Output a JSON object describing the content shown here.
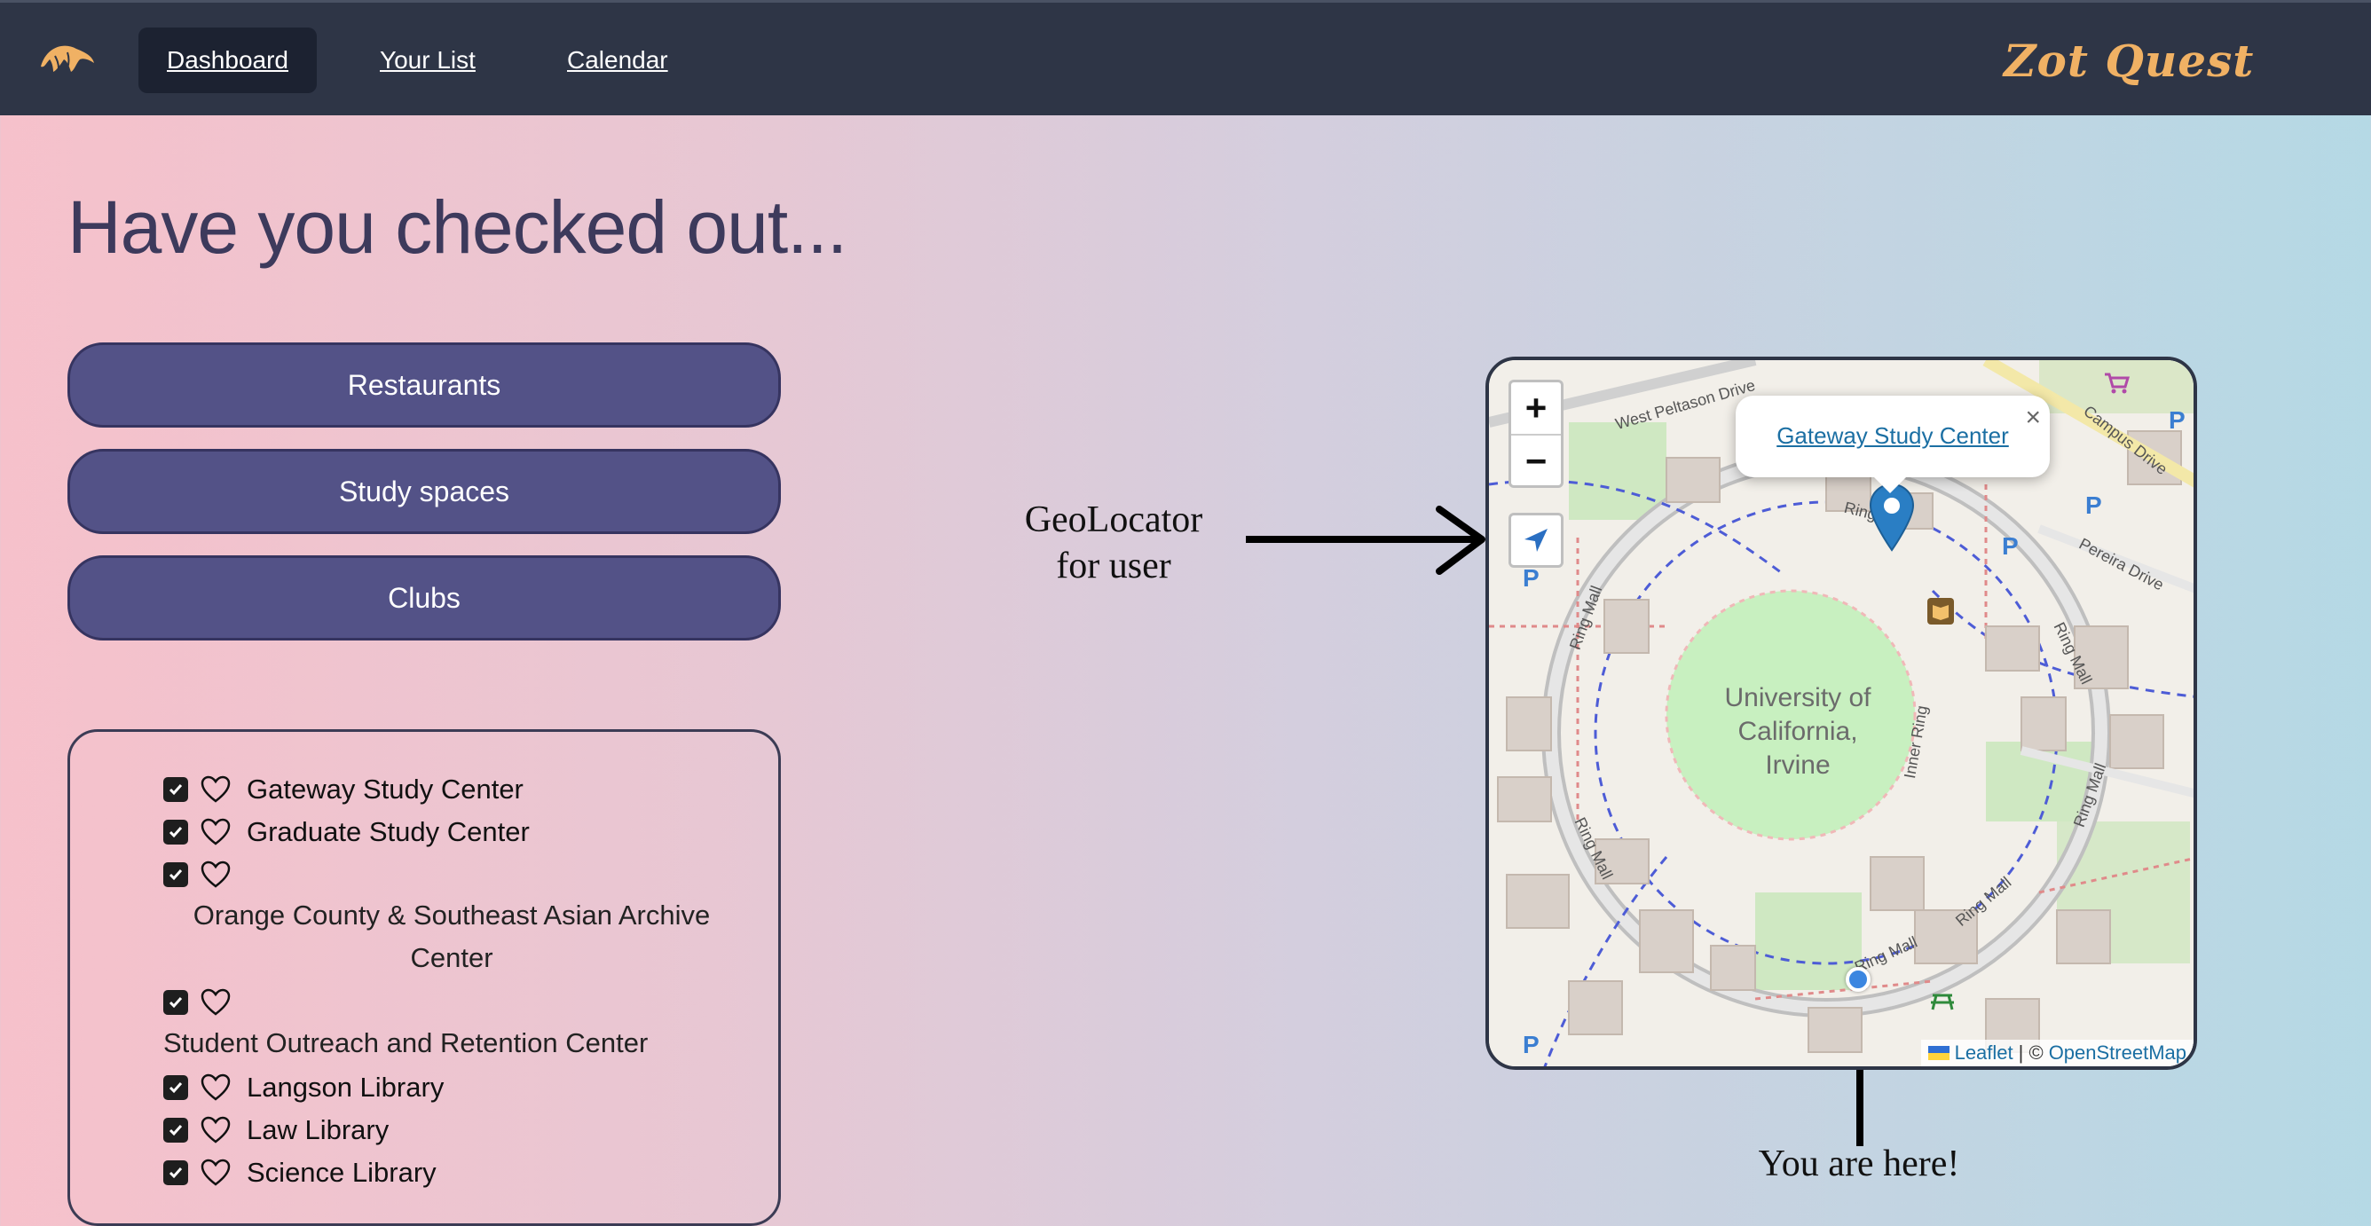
{
  "nav": {
    "logo_icon": "anteater-logo-icon",
    "links": [
      {
        "label": "Dashboard",
        "active": true
      },
      {
        "label": "Your List",
        "active": false
      },
      {
        "label": "Calendar",
        "active": false
      }
    ],
    "brand": "Zot Quest"
  },
  "main": {
    "headline": "Have you checked out...",
    "categories": [
      "Restaurants",
      "Study spaces",
      "Clubs"
    ]
  },
  "list": {
    "items": [
      {
        "label": "Gateway Study Center",
        "checked": true
      },
      {
        "label": "Graduate Study Center",
        "checked": true
      },
      {
        "label_line1": "Orange County & Southeast Asian Archive",
        "label_line2": "Center",
        "checked": true
      },
      {
        "label": "Student Outreach and Retention Center",
        "checked": true
      },
      {
        "label": "Langson Library",
        "checked": true
      },
      {
        "label": "Law Library",
        "checked": true
      },
      {
        "label": "Science Library",
        "checked": true
      }
    ]
  },
  "annotations": {
    "geolocator_line1": "GeoLocator",
    "geolocator_line2": "for user",
    "you_are_here": "You are here!"
  },
  "map": {
    "zoom_in": "+",
    "zoom_out": "−",
    "popup_link": "Gateway Study Center",
    "popup_close": "×",
    "campus_label_line1": "University of",
    "campus_label_line2": "California,",
    "campus_label_line3": "Irvine",
    "roads": {
      "west_peltason": "West Peltason Drive",
      "campus_drive": "Campus Drive",
      "pereira": "Pereira Drive",
      "ring_mall": "Ring Mall",
      "inner_ring": "Inner Ring",
      "ring": "Ring"
    },
    "attribution": {
      "leaflet": "Leaflet",
      "separator": "| ©",
      "osm": "OpenStreetMap"
    }
  },
  "colors": {
    "nav_bg": "#2e3546",
    "brand": "#f0b164",
    "button_bg": "#535287",
    "link": "#1b6fa3",
    "marker": "#2a7ec4",
    "user_dot": "#3b86e0"
  }
}
